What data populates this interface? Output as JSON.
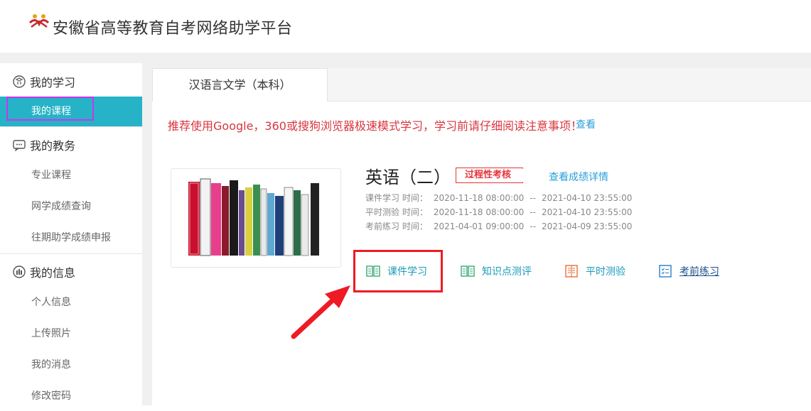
{
  "header": {
    "title": "安徽省高等教育自考网络助学平台"
  },
  "sidebar": {
    "groups": [
      {
        "title": "我的学习",
        "icon": "study-icon",
        "items": [
          {
            "label": "我的课程",
            "active": true
          }
        ]
      },
      {
        "title": "我的教务",
        "icon": "chat-icon",
        "items": [
          {
            "label": "专业课程"
          },
          {
            "label": "网学成绩查询"
          },
          {
            "label": "往期助学成绩申报"
          }
        ]
      },
      {
        "title": "我的信息",
        "icon": "info-icon",
        "items": [
          {
            "label": "个人信息"
          },
          {
            "label": "上传照片"
          },
          {
            "label": "我的消息"
          },
          {
            "label": "修改密码"
          }
        ]
      }
    ]
  },
  "tabs": [
    {
      "label": "汉语言文学（本科）"
    }
  ],
  "notice": {
    "text": "推荐使用Google，360或搜狗浏览器极速模式学习，学习前请仔细阅读注意事项！",
    "link": "查看"
  },
  "course": {
    "title": "英语（二）",
    "badge": "过程性考核",
    "score_link": "查看成绩详情",
    "times": [
      {
        "label": "课件学习 时间：",
        "start": "2020-11-18 08:00:00",
        "sep": "--",
        "end": "2021-04-10 23:55:00"
      },
      {
        "label": "平时测验 时间：",
        "start": "2020-11-18 08:00:00",
        "sep": "--",
        "end": "2021-04-10 23:55:00"
      },
      {
        "label": "考前练习 时间：",
        "start": "2021-04-01 09:00:00",
        "sep": "--",
        "end": "2021-04-09 23:55:00"
      }
    ],
    "actions": [
      {
        "label": "课件学习",
        "icon": "book-open-icon"
      },
      {
        "label": "知识点测评",
        "icon": "book-open-icon"
      },
      {
        "label": "平时测验",
        "icon": "notebook-icon"
      },
      {
        "label": "考前练习",
        "icon": "checklist-icon"
      }
    ]
  },
  "colors": {
    "accent": "#26b3c7",
    "notice": "#d9363e",
    "link": "#2a9fd8",
    "highlight": "#ee1b24",
    "outline": "#cc33ee"
  }
}
